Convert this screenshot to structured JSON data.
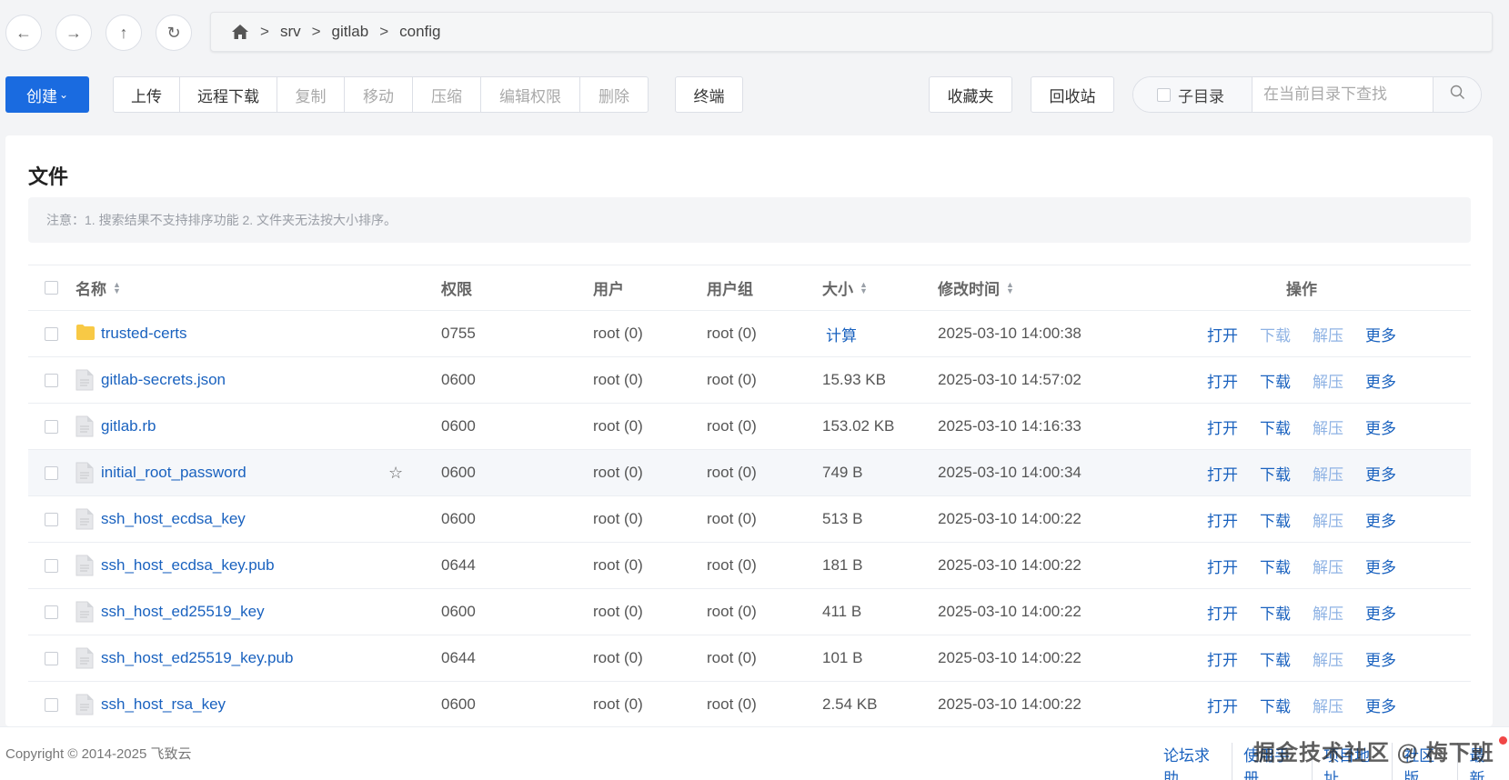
{
  "nav": {
    "back_icon": "arrow-left-icon",
    "forward_icon": "arrow-right-icon",
    "up_icon": "arrow-up-icon",
    "refresh_icon": "refresh-icon"
  },
  "breadcrumb": {
    "home_icon": "home-icon",
    "sep": ">",
    "parts": [
      "srv",
      "gitlab",
      "config"
    ]
  },
  "toolbar": {
    "create_label": "创建",
    "upload": "上传",
    "remote_download": "远程下载",
    "copy": "复制",
    "move": "移动",
    "compress": "压缩",
    "edit_perms": "编辑权限",
    "delete": "删除",
    "terminal": "终端",
    "favorites": "收藏夹",
    "recycle": "回收站",
    "subdir_label": "子目录",
    "search_placeholder": "在当前目录下查找"
  },
  "card": {
    "title": "文件",
    "notice": "注意：1. 搜索结果不支持排序功能 2. 文件夹无法按大小排序。"
  },
  "table": {
    "headers": {
      "name": "名称",
      "perm": "权限",
      "user": "用户",
      "group": "用户组",
      "size": "大小",
      "mtime": "修改时间",
      "ops": "操作"
    },
    "ops_labels": {
      "open": "打开",
      "download": "下载",
      "extract": "解压",
      "more": "更多"
    },
    "rows": [
      {
        "name": "trusted-certs",
        "type": "folder",
        "perm": "0755",
        "user": "root (0)",
        "group": "root (0)",
        "size": "计算",
        "mtime": "2025-03-10 14:00:38"
      },
      {
        "name": "gitlab-secrets.json",
        "type": "file",
        "perm": "0600",
        "user": "root (0)",
        "group": "root (0)",
        "size": "15.93 KB",
        "mtime": "2025-03-10 14:57:02"
      },
      {
        "name": "gitlab.rb",
        "type": "file",
        "perm": "0600",
        "user": "root (0)",
        "group": "root (0)",
        "size": "153.02 KB",
        "mtime": "2025-03-10 14:16:33"
      },
      {
        "name": "initial_root_password",
        "type": "file",
        "perm": "0600",
        "user": "root (0)",
        "group": "root (0)",
        "size": "749 B",
        "mtime": "2025-03-10 14:00:34"
      },
      {
        "name": "ssh_host_ecdsa_key",
        "type": "file",
        "perm": "0600",
        "user": "root (0)",
        "group": "root (0)",
        "size": "513 B",
        "mtime": "2025-03-10 14:00:22"
      },
      {
        "name": "ssh_host_ecdsa_key.pub",
        "type": "file",
        "perm": "0644",
        "user": "root (0)",
        "group": "root (0)",
        "size": "181 B",
        "mtime": "2025-03-10 14:00:22"
      },
      {
        "name": "ssh_host_ed25519_key",
        "type": "file",
        "perm": "0600",
        "user": "root (0)",
        "group": "root (0)",
        "size": "411 B",
        "mtime": "2025-03-10 14:00:22"
      },
      {
        "name": "ssh_host_ed25519_key.pub",
        "type": "file",
        "perm": "0644",
        "user": "root (0)",
        "group": "root (0)",
        "size": "101 B",
        "mtime": "2025-03-10 14:00:22"
      },
      {
        "name": "ssh_host_rsa_key",
        "type": "file",
        "perm": "0600",
        "user": "root (0)",
        "group": "root (0)",
        "size": "2.54 KB",
        "mtime": "2025-03-10 14:00:22"
      }
    ]
  },
  "footer": {
    "copyright": "Copyright © 2014-2025 飞致云",
    "links": [
      "论坛求助",
      "使用手册",
      "项目地址",
      "社区版",
      "最新"
    ],
    "watermark": "掘金技术社区 @ 梅下班"
  },
  "colors": {
    "accent": "#1a6be0",
    "link": "#1a62bf",
    "folder": "#f8c945"
  }
}
